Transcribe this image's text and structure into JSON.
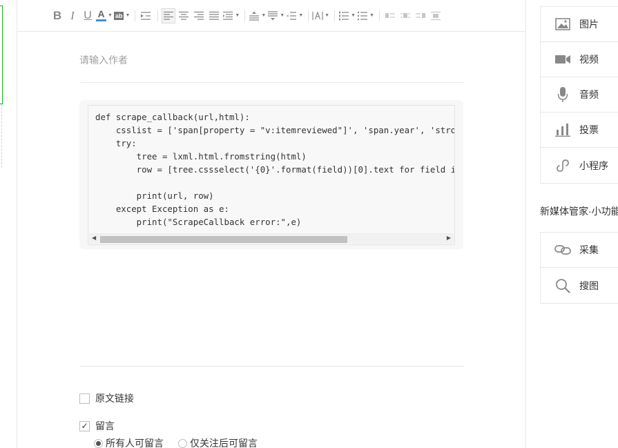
{
  "editor": {
    "author_placeholder": "请输入作者",
    "code_lines": [
      "def scrape_callback(url,html):",
      "    csslist = ['span[property = \"v:itemreviewed\"]', 'span.year', 'stro",
      "    try:",
      "        tree = lxml.html.fromstring(html)",
      "        row = [tree.cssselect('{0}'.format(field))[0].text for field i",
      "",
      "        print(url, row)",
      "    except Exception as e:",
      "        print(\"ScrapeCallback error:\",e)"
    ],
    "original_link_label": "原文链接",
    "comment_label": "留言",
    "comment_options": [
      "所有人可留言",
      "仅关注后可留言"
    ]
  },
  "right_panel": {
    "media_items": [
      {
        "label": "图片",
        "icon": "image-icon"
      },
      {
        "label": "视频",
        "icon": "video-icon"
      },
      {
        "label": "音频",
        "icon": "microphone-icon"
      },
      {
        "label": "投票",
        "icon": "bar-chart-icon"
      },
      {
        "label": "小程序",
        "icon": "mini-program-icon"
      }
    ],
    "section_title": "新媒体管家·小功能",
    "tool_items": [
      {
        "label": "采集",
        "icon": "link-icon"
      },
      {
        "label": "搜图",
        "icon": "search-icon"
      }
    ]
  },
  "colors": {
    "accent_green": "#1aad19",
    "icon_gray": "#8a8a8a",
    "font_color_bar": "#3d8ee6"
  }
}
